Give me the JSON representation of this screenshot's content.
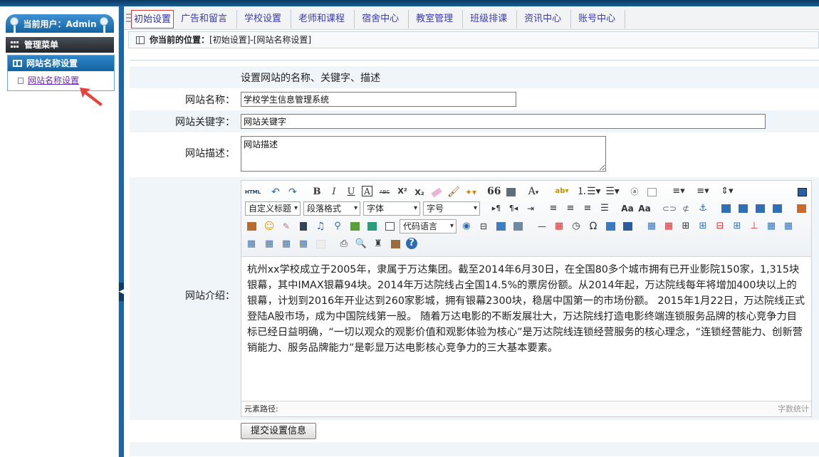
{
  "user": {
    "label": "当前用户：Admin"
  },
  "menu": {
    "title": "管理菜单",
    "group_title": "网站名称设置",
    "group_item": "网站名称设置"
  },
  "nav": {
    "items": [
      "初始设置",
      "广告和留言",
      "学校设置",
      "老师和课程",
      "宿舍中心",
      "教室管理",
      "班级排课",
      "资讯中心",
      "账号中心"
    ],
    "active_index": 0
  },
  "breadcrumb": {
    "label": "你当前的位置：",
    "path": "[初始设置]-[网站名称设置]"
  },
  "form": {
    "heading": "设置网站的名称、关键字、描述",
    "site_name_label": "网站名称：",
    "site_name_value": "学校学生信息管理系统",
    "keywords_label": "网站关键字：",
    "keywords_value": "网站关键字",
    "description_label": "网站描述：",
    "description_value": "网站描述",
    "intro_label": "网站介绍：",
    "submit_label": "提交设置信息"
  },
  "editor": {
    "selects": {
      "custom_title": "自定义标题",
      "paragraph": "段落格式",
      "font_family": "字体",
      "font_size": "字号",
      "code_language": "代码语言"
    },
    "content": "杭州xx学校成立于2005年，隶属于万达集团。截至2014年6月30日，在全国80多个城市拥有已开业影院150家，1,315块银幕，其中IMAX银幕94块。2014年万达院线占全国14.5%的票房份额。从2014年起，万达院线每年将增加400块以上的银幕，计划到2016年开业达到260家影城，拥有银幕2300块，稳居中国第一的市场份额。 2015年1月22日，万达院线正式登陆A股市场，成为中国院线第一股。 随着万达电影的不断发展壮大，万达院线打造电影终端连锁服务品牌的核心竞争力目标已经日益明确，“一切以观众的观影价值和观影体验为核心”是万达院线连锁经营服务的核心理念，“连锁经营能力、创新营销能力、服务品牌能力”是彰显万达电影核心竞争力的三大基本要素。",
    "element_path": "元素路径:",
    "word_count": "字数统计",
    "html_label": "HTML",
    "bold": "B",
    "italic": "I",
    "underline": "U",
    "strike": "ABC",
    "quote": "66",
    "font_color": "A",
    "omega": "Ω"
  },
  "colors": {
    "nav_link": "#3b3ab5",
    "active_border": "#e23b3b",
    "sidebar_blue": "#1668ad"
  }
}
